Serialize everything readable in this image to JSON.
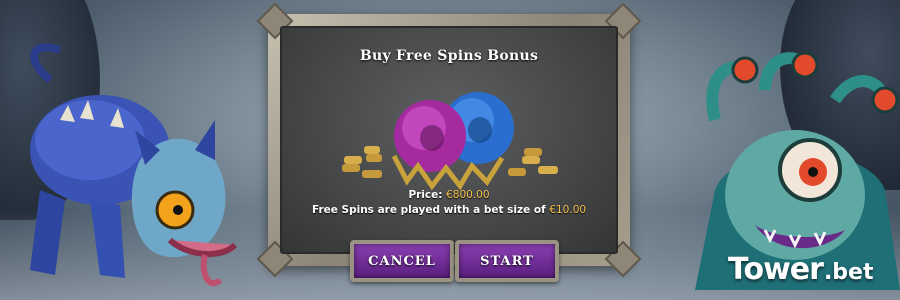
{
  "dialog": {
    "title": "Buy Free Spins Bonus",
    "price_label": "Price:",
    "price_value": "€800.00",
    "bet_text": "Free Spins are played with a bet size of",
    "bet_value": "€10.00",
    "cancel_label": "CANCEL",
    "start_label": "START"
  },
  "brand": {
    "logo_main": "Tower",
    "logo_suffix": ".bet"
  },
  "icons": {
    "left_character": "blue-hound-monster",
    "right_character": "medusa-beholder-monster",
    "orbs": "purple-and-blue-skull-orbs",
    "coins": "gold-coin-stacks"
  },
  "colors": {
    "button": "#6a2a92",
    "gold_text": "#f5c14a",
    "panel": "#4a4b4c",
    "frame": "#a69e8c"
  }
}
